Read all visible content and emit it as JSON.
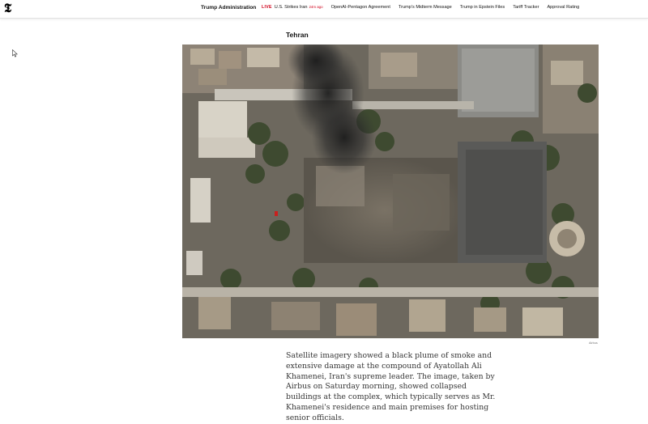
{
  "nav": {
    "logo_glyph": "𝕿",
    "section_title": "Trump Administration",
    "live_label": "LIVE",
    "live_story": "U.S. Strikes Iran",
    "live_time": "24m ago",
    "links": [
      "OpenAI-Pentagon Agreement",
      "Trump's Midterm Message",
      "Trump in Epstein Files",
      "Tariff Tracker",
      "Approval Rating"
    ]
  },
  "article": {
    "image_title": "Tehran",
    "photo_credit": "Airbus",
    "caption": "Satellite imagery showed a black plume of smoke and extensive damage at the compound of Ayatollah Ali Khamenei, Iran's supreme leader. The image, taken by Airbus on Saturday morning, showed collapsed buildings at the complex, which typically serves as Mr. Khamenei's residence and main premises for hosting senior officials."
  },
  "colors": {
    "live_red": "#d0021b",
    "text": "#121212",
    "body_text": "#363636"
  }
}
